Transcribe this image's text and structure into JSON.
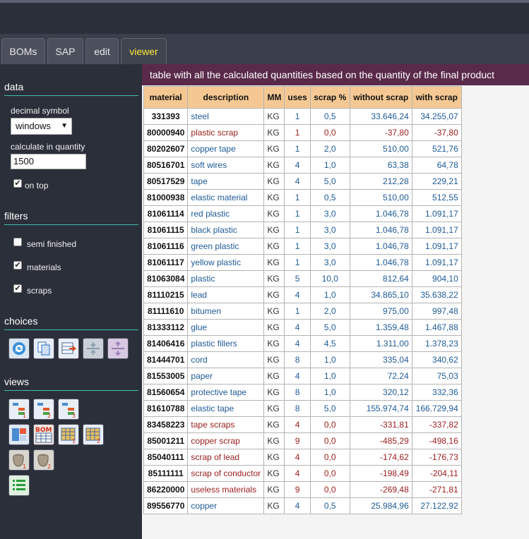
{
  "tabs": [
    {
      "label": "BOMs",
      "active": false
    },
    {
      "label": "SAP",
      "active": false
    },
    {
      "label": "edit",
      "active": false
    },
    {
      "label": "viewer",
      "active": true
    }
  ],
  "sidebar": {
    "data_title": "data",
    "decimal_label": "decimal symbol",
    "decimal_value": "windows",
    "calc_label": "calculate in quantity",
    "calc_value": "1500",
    "on_top_label": "on top",
    "on_top_checked": true,
    "filters_title": "filters",
    "filters": [
      {
        "label": "semi finished",
        "checked": false
      },
      {
        "label": "materials",
        "checked": true
      },
      {
        "label": "scraps",
        "checked": true
      }
    ],
    "choices_title": "choices",
    "choices_icons": [
      "refresh-icon",
      "copy-pages-icon",
      "export-table-icon",
      "collapse-icon",
      "expand-icon"
    ],
    "views_title": "views",
    "views_icons": [
      "tree-view-1-icon",
      "tree-view-2-icon",
      "tree-view-3-icon",
      "split-view-icon",
      "bom-table-icon",
      "table-view-1-icon",
      "table-view-2-icon",
      "bag-1-icon",
      "bag-2-icon",
      "list-view-icon"
    ]
  },
  "main": {
    "header": "table with all the calculated quantities based on the quantity of the final product",
    "columns": [
      "material",
      "description",
      "MM",
      "uses",
      "scrap %",
      "without scrap",
      "with scrap"
    ],
    "rows": [
      {
        "material": "331393",
        "description": "steel",
        "mm": "KG",
        "uses": "1",
        "scrap": "0,5",
        "without": "33.646,24",
        "with": "34.255,07",
        "neg": false
      },
      {
        "material": "80000940",
        "description": "plastic scrap",
        "mm": "KG",
        "uses": "1",
        "scrap": "0,0",
        "without": "-37,80",
        "with": "-37,80",
        "neg": true
      },
      {
        "material": "80202607",
        "description": "copper tape",
        "mm": "KG",
        "uses": "1",
        "scrap": "2,0",
        "without": "510,00",
        "with": "521,76",
        "neg": false
      },
      {
        "material": "80516701",
        "description": "soft wires",
        "mm": "KG",
        "uses": "4",
        "scrap": "1,0",
        "without": "63,38",
        "with": "64,78",
        "neg": false
      },
      {
        "material": "80517529",
        "description": "tape",
        "mm": "KG",
        "uses": "4",
        "scrap": "5,0",
        "without": "212,28",
        "with": "229,21",
        "neg": false
      },
      {
        "material": "81000938",
        "description": "elastic material",
        "mm": "KG",
        "uses": "1",
        "scrap": "0,5",
        "without": "510,00",
        "with": "512,55",
        "neg": false
      },
      {
        "material": "81061114",
        "description": "red plastic",
        "mm": "KG",
        "uses": "1",
        "scrap": "3,0",
        "without": "1.046,78",
        "with": "1.091,17",
        "neg": false
      },
      {
        "material": "81061115",
        "description": "black plastic",
        "mm": "KG",
        "uses": "1",
        "scrap": "3,0",
        "without": "1.046,78",
        "with": "1.091,17",
        "neg": false
      },
      {
        "material": "81061116",
        "description": "green plastic",
        "mm": "KG",
        "uses": "1",
        "scrap": "3,0",
        "without": "1.046,78",
        "with": "1.091,17",
        "neg": false
      },
      {
        "material": "81061117",
        "description": "yellow plastic",
        "mm": "KG",
        "uses": "1",
        "scrap": "3,0",
        "without": "1.046,78",
        "with": "1.091,17",
        "neg": false
      },
      {
        "material": "81063084",
        "description": "plastic",
        "mm": "KG",
        "uses": "5",
        "scrap": "10,0",
        "without": "812,64",
        "with": "904,10",
        "neg": false
      },
      {
        "material": "81110215",
        "description": "lead",
        "mm": "KG",
        "uses": "4",
        "scrap": "1,0",
        "without": "34.865,10",
        "with": "35.638,22",
        "neg": false
      },
      {
        "material": "81111610",
        "description": "bitumen",
        "mm": "KG",
        "uses": "1",
        "scrap": "2,0",
        "without": "975,00",
        "with": "997,48",
        "neg": false
      },
      {
        "material": "81333112",
        "description": "glue",
        "mm": "KG",
        "uses": "4",
        "scrap": "5,0",
        "without": "1.359,48",
        "with": "1.467,88",
        "neg": false
      },
      {
        "material": "81406416",
        "description": "plastic fillers",
        "mm": "KG",
        "uses": "4",
        "scrap": "4,5",
        "without": "1.311,00",
        "with": "1.378,23",
        "neg": false
      },
      {
        "material": "81444701",
        "description": "cord",
        "mm": "KG",
        "uses": "8",
        "scrap": "1,0",
        "without": "335,04",
        "with": "340,62",
        "neg": false
      },
      {
        "material": "81553005",
        "description": "paper",
        "mm": "KG",
        "uses": "4",
        "scrap": "1,0",
        "without": "72,24",
        "with": "75,03",
        "neg": false
      },
      {
        "material": "81560654",
        "description": "protective tape",
        "mm": "KG",
        "uses": "8",
        "scrap": "1,0",
        "without": "320,12",
        "with": "332,36",
        "neg": false
      },
      {
        "material": "81610788",
        "description": "elastic tape",
        "mm": "KG",
        "uses": "8",
        "scrap": "5,0",
        "without": "155.974,74",
        "with": "166.729,94",
        "neg": false
      },
      {
        "material": "83458223",
        "description": "tape scraps",
        "mm": "KG",
        "uses": "4",
        "scrap": "0,0",
        "without": "-331,81",
        "with": "-337,82",
        "neg": true
      },
      {
        "material": "85001211",
        "description": "copper scrap",
        "mm": "KG",
        "uses": "9",
        "scrap": "0,0",
        "without": "-485,29",
        "with": "-498,16",
        "neg": true
      },
      {
        "material": "85040111",
        "description": "scrap of lead",
        "mm": "KG",
        "uses": "4",
        "scrap": "0,0",
        "without": "-174,62",
        "with": "-176,73",
        "neg": true
      },
      {
        "material": "85111111",
        "description": "scrap of conductor",
        "mm": "KG",
        "uses": "4",
        "scrap": "0,0",
        "without": "-198,49",
        "with": "-204,11",
        "neg": true
      },
      {
        "material": "86220000",
        "description": "useless materials",
        "mm": "KG",
        "uses": "9",
        "scrap": "0,0",
        "without": "-269,48",
        "with": "-271,81",
        "neg": true
      },
      {
        "material": "89556770",
        "description": "copper",
        "mm": "KG",
        "uses": "4",
        "scrap": "0,5",
        "without": "25.984,96",
        "with": "27.122,92",
        "neg": false
      }
    ]
  },
  "colors": {
    "accent_tab": "#ffea3a",
    "header_bar": "#5a2a4a",
    "table_header": "#f5c893",
    "positive_text": "#1e5a96",
    "negative_text": "#9b1c1c",
    "section_line": "#3fbfae"
  }
}
